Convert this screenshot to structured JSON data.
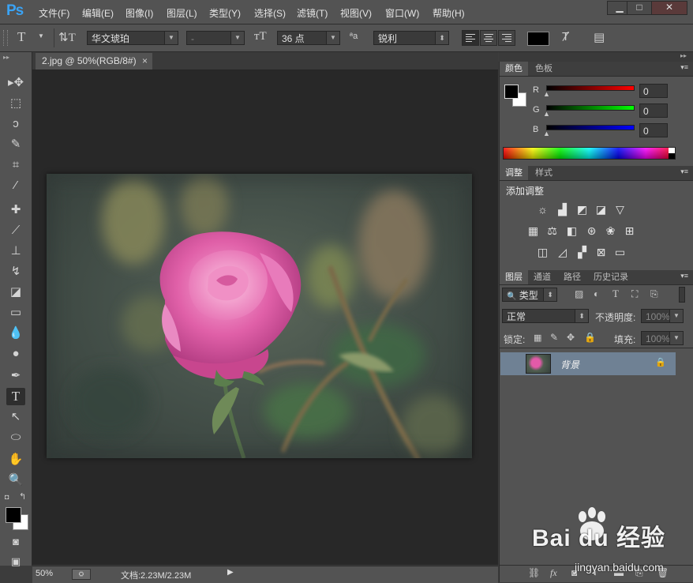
{
  "app": {
    "logo": "Ps"
  },
  "menu": [
    "文件(F)",
    "编辑(E)",
    "图像(I)",
    "图层(L)",
    "类型(Y)",
    "选择(S)",
    "滤镜(T)",
    "视图(V)",
    "窗口(W)",
    "帮助(H)"
  ],
  "window_controls": {
    "minimize": "▁",
    "maximize": "□",
    "close": "✕"
  },
  "options": {
    "font_family": "华文琥珀",
    "font_style": "-",
    "font_size": "36 点",
    "aa_label": "ªa",
    "antialias": "锐利",
    "text_color": "#000000"
  },
  "document": {
    "tab_title": "2.jpg @ 50%(RGB/8#)",
    "tab_close": "×"
  },
  "status": {
    "zoom": "50%",
    "doc_size": "文档:2.23M/2.23M"
  },
  "color_panel": {
    "tabs": [
      "颜色",
      "色板"
    ],
    "channels": [
      {
        "label": "R",
        "value": "0",
        "color": "#ff0000"
      },
      {
        "label": "G",
        "value": "0",
        "color": "#00ff00"
      },
      {
        "label": "B",
        "value": "0",
        "color": "#0000ff"
      }
    ]
  },
  "adjustments_panel": {
    "tabs": [
      "调整",
      "样式"
    ],
    "title": "添加调整"
  },
  "layers_panel": {
    "tabs": [
      "图层",
      "通道",
      "路径",
      "历史记录"
    ],
    "filter_label": "类型",
    "blend_mode": "正常",
    "opacity_label": "不透明度:",
    "opacity_value": "100%",
    "lock_label": "锁定:",
    "fill_label": "填充:",
    "fill_value": "100%",
    "layers": [
      {
        "name": "背景",
        "visible": true,
        "locked": true
      }
    ]
  },
  "watermark": {
    "brand": "Bai du 经验",
    "url": "jingyan.baidu.com"
  }
}
